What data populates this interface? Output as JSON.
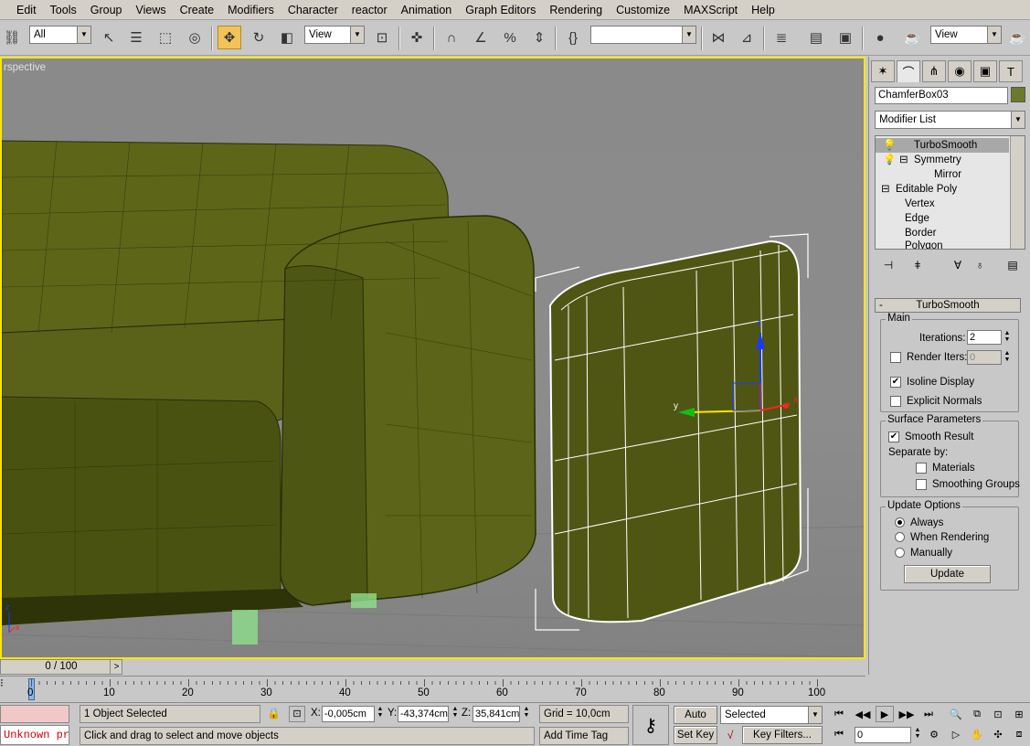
{
  "menu": [
    "Edit",
    "Tools",
    "Group",
    "Views",
    "Create",
    "Modifiers",
    "Character",
    "reactor",
    "Animation",
    "Graph Editors",
    "Rendering",
    "Customize",
    "MAXScript",
    "Help"
  ],
  "toolbar": {
    "selection_filter": "All",
    "ref_coord": "View",
    "named_sel_set": "",
    "render_view": "View"
  },
  "viewport": {
    "label": "rspective",
    "axis_labels": {
      "y": "y",
      "x": "x",
      "z": "z",
      "corner_z": "z",
      "corner_x": "x"
    }
  },
  "command_panel": {
    "object_name": "ChamferBox03",
    "object_color": "#6b7a2a",
    "modifier_list": "Modifier List",
    "stack": [
      {
        "label": "TurboSmooth",
        "selected": true
      },
      {
        "label": "Symmetry",
        "selected": false
      },
      {
        "label": "Mirror",
        "selected": false
      },
      {
        "label": "Editable Poly",
        "selected": false
      },
      {
        "label": "Vertex",
        "selected": false
      },
      {
        "label": "Edge",
        "selected": false
      },
      {
        "label": "Border",
        "selected": false
      },
      {
        "label": "Polygon",
        "selected": false
      }
    ],
    "rollout": {
      "title": "TurboSmooth",
      "collapse": "-",
      "main_group": "Main",
      "iterations_label": "Iterations:",
      "iterations_value": "2",
      "render_iters_label": "Render Iters:",
      "render_iters_value": "0",
      "render_iters_checked": false,
      "isoline_label": "Isoline Display",
      "isoline_checked": true,
      "explicit_normals_label": "Explicit Normals",
      "explicit_normals_checked": false,
      "surface_group": "Surface Parameters",
      "smooth_result_label": "Smooth Result",
      "smooth_result_checked": true,
      "separate_by": "Separate by:",
      "materials_label": "Materials",
      "smoothing_groups_label": "Smoothing Groups",
      "update_group": "Update Options",
      "always_label": "Always",
      "when_rendering_label": "When Rendering",
      "manually_label": "Manually",
      "update_button": "Update"
    }
  },
  "timeline": {
    "slider": "0 / 100",
    "next": ">",
    "ticks": [
      "0",
      "10",
      "20",
      "30",
      "40",
      "50",
      "60",
      "70",
      "80",
      "90",
      "100"
    ]
  },
  "status": {
    "maxscript_listener": "Unknown pr",
    "selection": "1 Object Selected",
    "prompt": "Click and drag to select and move objects",
    "x_label": "X:",
    "x_value": "-0,005cm",
    "y_label": "Y:",
    "y_value": "-43,374cm",
    "z_label": "Z:",
    "z_value": "35,841cm",
    "grid": "Grid = 10,0cm",
    "add_time_tag": "Add Time Tag",
    "auto_key": "Auto Key",
    "set_key": "Set Key",
    "key_mode": "Selected",
    "key_filters": "Key Filters...",
    "frame": "0"
  }
}
